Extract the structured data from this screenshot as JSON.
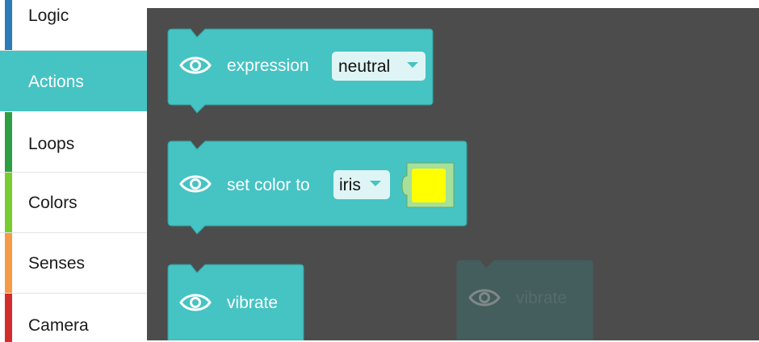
{
  "sidebar": {
    "categories": [
      {
        "label": "Logic",
        "color": "#2b7bb9"
      },
      {
        "label": "Actions",
        "color": "#46c3c3",
        "selected": true
      },
      {
        "label": "Loops",
        "color": "#2e9e44"
      },
      {
        "label": "Colors",
        "color": "#79cc2f"
      },
      {
        "label": "Senses",
        "color": "#f59a46"
      },
      {
        "label": "Camera",
        "color": "#d42c2c"
      }
    ]
  },
  "blocks": {
    "expression": {
      "label": "expression",
      "value": "neutral",
      "icon": "eye-icon"
    },
    "set_color": {
      "label": "set color to",
      "value": "iris",
      "swatch_color": "#ffff00",
      "icon": "eye-icon"
    },
    "vibrate": {
      "label": "vibrate",
      "icon": "eye-icon"
    },
    "vibrate_ghost": {
      "label": "vibrate",
      "icon": "eye-icon"
    }
  },
  "theme": {
    "block_color": "#46c3c3",
    "block_border": "#339e9e",
    "dropdown_bg": "#dff5f5",
    "workspace_bg": "#4c4c4c"
  }
}
